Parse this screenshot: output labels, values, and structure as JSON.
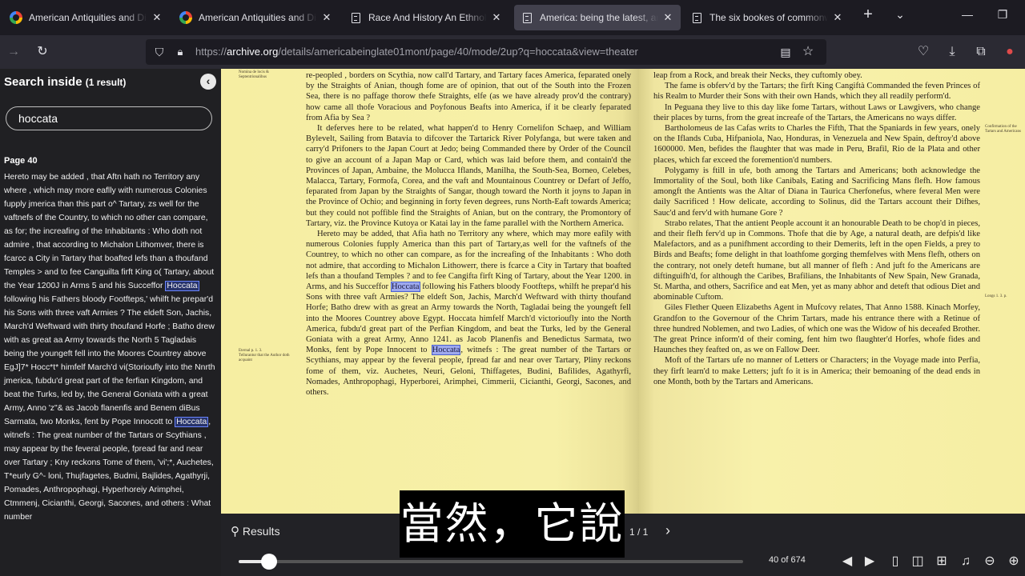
{
  "tabs": [
    {
      "label": "American Antiquities and Dis",
      "icon": "google-icon"
    },
    {
      "label": "American Antiquities and Dis",
      "icon": "google-icon"
    },
    {
      "label": "Race And History An Ethnolo",
      "icon": "document-icon"
    },
    {
      "label": "America: being the latest, an",
      "icon": "document-icon",
      "active": true
    },
    {
      "label": "The six bookes of commonw",
      "icon": "document-icon"
    }
  ],
  "url": {
    "prefix": "https://",
    "domain": "archive.org",
    "path": "/details/americabeinglate01mont/page/40/mode/2up?q=hoccata&view=theater"
  },
  "sidebar": {
    "title": "Search inside",
    "count": "(1 result)",
    "query": "hoccata",
    "page_label": "Page 40",
    "snippet_parts": [
      "Hereto may be added , that Aftn hath no Territory any where , which may more eaflly with numerous Colonies fupply jmerica than this part o^ Tartary, zs well for the vaftnefs of the Country, to which no other can compare, as for; the increafing of the Inhabitants : Who doth not admire , that according to Michalon Lithomver, there is fcarcc a City in Tartary that boafted lefs than a thoufand Temples > and to fee Canguilta firft King o( Tartary, about the Year 1200J in Arms 5 and his Succeffor ",
      "Hoccata",
      " following his Fathers bloody Footfteps,' whilft he prepar'd his Sons with three vaft Armies ? The eldeft Son, Jachis, March'd Weftward with thirty thoufand Horfe ; Batho drew with as great aa Army towards the North 5 Tagladais being the youngeft fell into the Moores Countrey above EgJ]7* Hocc*t* himfelf March'd vi(Storioufly into the Nnrth jmerica, fubdu'd great part of the ferfian Kingdom, and beat the Turks, led by, the General Goniata with a great Army, Anno 'z\"& as Jacob flanenfis and Benem diBus Sarmata, two Monks, fent by Pope Innocott to ",
      "Hoccata",
      ", witnefs : The great number of the Tartars or Scythians , may appear by the feveral people, fpread far and near over Tartary ; Kny reckons Tome of them, 'vi';*, Auchetes, T*eurly G^- loni, Thujfagetes, Budmi, Bajlides, Agathyrji, Pomades, Anthropophagi, Hyperhoreiy Arimphei, Ctmmenj, Cicianthi, Georgi, Sacones, and others : What number"
    ]
  },
  "book": {
    "left_paragraphs": [
      [
        "re-peopled , borders on Scythia, now call'd Tartary, and Tartary faces America, feparated onely by the Straights of Anian, though fome are of opinion, that out of the South into the Frozen Sea, there is no paffage thorow thefe Straights, elfe (as we have already prov'd the contrary) how came all thofe Voracious and Poyfonous Beafts into America, if it be clearly feparated from Afia by Sea ?"
      ],
      [
        "It deferves here to be related, what happen'd to Henry Cornelifon Schaep, and William Bylevelt, Sailing from Batavia to difcover the Tartarick River Polyfanga, but were taken and carry'd Prifoners to the Japan Court at Jedo; being Commanded there by Order of the Council to give an account of a Japan Map or Card, which was laid before them, and contain'd the Provinces of Japan, Ambaine, the Molucca Iflands, Manilha, the South-Sea, Borneo, Celebes, Malacca, Tartary, Formofa, Corea, and the vaft and Mountainous Countrey or Defart of Jeffo, feparated from Japan by the Straights of Sangar, though toward the North it joyns to Japan in the Province of Ochio; and beginning in forty feven degrees, runs North-Eaft towards America; but they could not poffible find the Straights of Anian, but on the contrary, the Promontory of Tartary, viz. the Province Kutoya or Katai lay in the fame parallel with the Northern America."
      ],
      [
        "Hereto may be added, that Afia hath no Territory any where, which may more eafily with numerous Colonies fupply America than this part of Tartary,as well for the vaftnefs of the Countrey, to which no other can compare, as for the increafing of the Inhabitants : Who doth not admire, that according to Michalon Lithowerr, there is fcarce a City in Tartary that boafted lefs than a thoufand Temples ? and to fee Cangifta firft King of Tartary, about the Year 1200. in Arms, and his Succeffor ",
        "Hoccata",
        " following his Fathers bloody Footfteps, whilft he prepar'd his Sons with three vaft Armies? The eldeft Son, Jachis, March'd Weftward with thirty thoufand Horfe; Batho drew with as great an Army towards the North, Tagladai being the youngeft fell into the Moores Countrey above Egypt. Hoccata himfelf March'd victorioufly into the North America, fubdu'd great part of the Perfian Kingdom, and beat the Turks, led by the General Goniata with a great Army, Anno 1241. as Jacob Planenfis and Benedictus Sarmata, two Monks, fent by Pope Innocent to ",
        "Hoccata",
        ", witnefs : The great number of the Tartars or Scythians, may appear by the feveral people, fpread far and near over Tartary, Pliny reckons fome of them, viz. Auchetes, Neuri, Geloni, Thiffagetes, Budini, Bafilides, Agathyrfi, Nomades, Anthropophagi, Hyperborei, Arimphei, Cimmerii, Cicianthi, Georgi, Sacones, and others."
      ]
    ],
    "right_paragraphs": [
      [
        "leap from a Rock, and break their Necks, they cuftomly obey."
      ],
      [
        "The fame is obferv'd by the Tartars; the firft King Cangiftà Commanded the feven Princes of his Realm to Murder their Sons with their own Hands, which they all readily perform'd."
      ],
      [
        "In Peguana they live to this day like fome Tartars, without Laws or Lawgivers, who change their places by turns, from the great increafe of the Tartars, the Americans no ways differ."
      ],
      [
        "Bartholomeus de las Cafas writs to Charles the Fifth, That the Spaniards in few years, onely on the Iflands Cuba, Hifpaniola, Nao, Honduras, in Venezuela and New Spain, deftroy'd above 1600000. Men, befides the flaughter that was made in Peru, Brafil, Rio de la Plata and other places, which far exceed the foremention'd numbers."
      ],
      [
        "Polygamy is ftill in ufe, both among the Tartars and Americans; both acknowledge the Immortality of the Soul, both like Canibals, Eating and Sacrificing Mans flefh. How famous amongft the Antients was the Altar of Diana in Taurica Cherfonefus, where feveral Men were daily Sacrificed ! How delicate, according to Solinus, did the Tartars account their Difhes, Sauc'd and ferv'd with humane Gore ?"
      ],
      [
        "Strabo relates, That the antient People account it an honourable Death to be chop'd in pieces, and their flefh ferv'd up in Commons. Thofe that die by Age, a natural death, are defpis'd like Malefactors, and as a punifhment according to their Demerits, left in the open Fields, a prey to Birds and Beafts; fome delight in that loathfome gorging themfelves with Mens flefh, others on the contrary, not onely deteft humane, but all manner of flefh : And juft fo the Americans are diftinguifh'd, for although the Caribes, Brafilians, the Inhabitants of New Spain, New Granada, St. Martha, and others, Sacrifice and eat Men, yet as many abhor and deteft that odious Diet and abominable Cuftom."
      ],
      [
        "Giles Flether Queen Elizabeths Agent in Mufcovy relates, That Anno 1588. Kinach Morfey, Grandfon to the Governour of the Chrim Tartars, made his entrance there with a Retinue of three hundred Noblemen, and two Ladies, of which one was the Widow of his deceafed Brother. The great Prince inform'd of their coming, fent him two flaughter'd Horfes, whofe fides and Haunches they feafted on, as we on Fallow Deer."
      ],
      [
        "Moft of the Tartars ufe no manner of Letters or Characters; in the Voyage made into Perfia, they firft learn'd to make Letters; juft fo it is in America; their bemoaning of the dead ends in one Month, both by the Tartars and Americans."
      ]
    ],
    "left_margin_notes": [
      "Nomina de locis & Septentrionalibus",
      "Eternal p. 1. 3.\nTellurantur that the Author doth acquaint"
    ],
    "right_margin_notes": [
      "Confirmation of the Tartars and Americans",
      "Longs 1. 3. p."
    ]
  },
  "bottom": {
    "results_label": "Results",
    "result_position": "1 / 1",
    "leaf_info": "40 of 674",
    "slider_progress": 0.06
  },
  "subtitle": "當然，它說"
}
